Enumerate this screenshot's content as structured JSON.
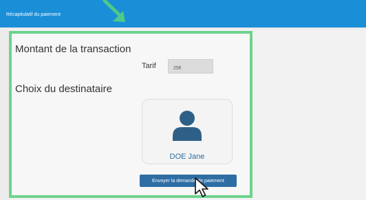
{
  "header": {
    "title": "Récapitulatif du paiement"
  },
  "amount_section": {
    "heading": "Montant de la transaction",
    "tarif_label": "Tarif",
    "tarif_value": "25€"
  },
  "recipient_section": {
    "heading": "Choix du destinataire",
    "recipient_name": "DOE Jane"
  },
  "actions": {
    "send_label": "Envoyer la demande de paiement"
  },
  "icons": {
    "annotation_arrow": "arrow-down-right-icon",
    "avatar": "user-avatar-icon",
    "cursor": "mouse-pointer-icon"
  },
  "colors": {
    "header_bg": "#1a8fd8",
    "highlight_border": "#6ed38d",
    "button_bg": "#2e6da4",
    "avatar": "#2e6087"
  }
}
